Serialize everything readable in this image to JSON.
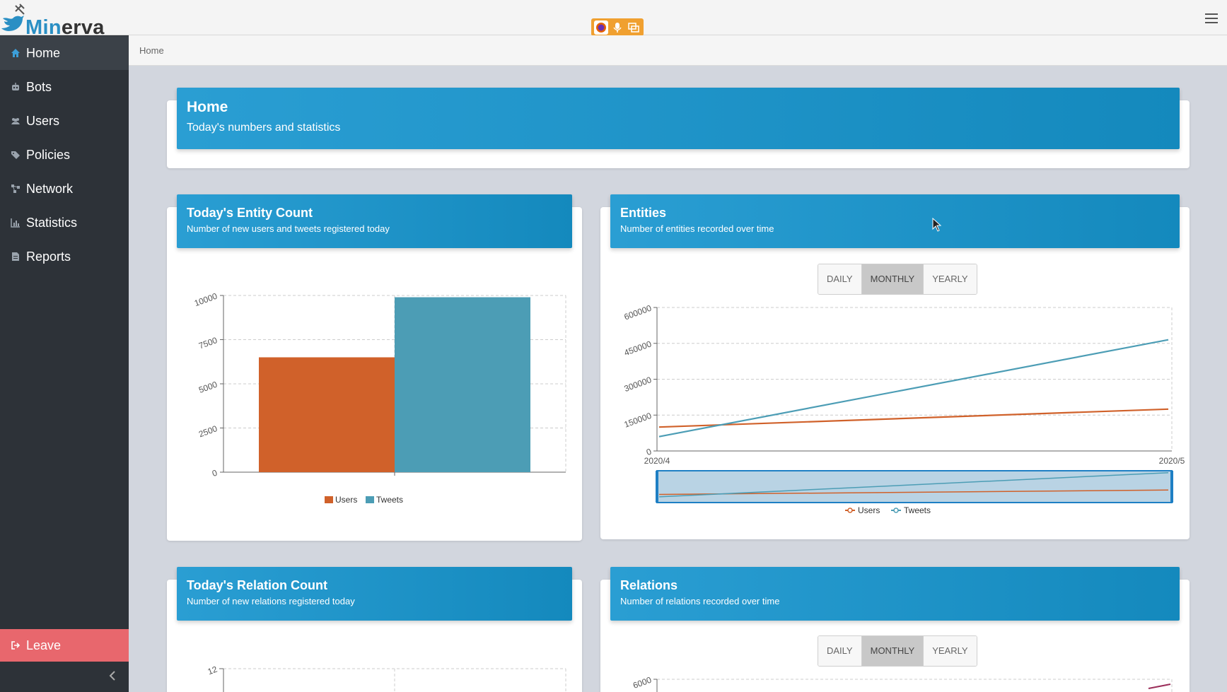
{
  "app": {
    "logo_part1": "Min",
    "logo_part2": "erva"
  },
  "nav": {
    "items": [
      {
        "label": "Home",
        "icon": "home-icon"
      },
      {
        "label": "Bots",
        "icon": "robot-icon"
      },
      {
        "label": "Users",
        "icon": "users-icon"
      },
      {
        "label": "Policies",
        "icon": "tags-icon"
      },
      {
        "label": "Network",
        "icon": "network-icon"
      },
      {
        "label": "Statistics",
        "icon": "chart-icon"
      },
      {
        "label": "Reports",
        "icon": "file-icon"
      }
    ],
    "leave_label": "Leave"
  },
  "breadcrumb": "Home",
  "home_card": {
    "title": "Home",
    "subtitle": "Today's numbers and statistics"
  },
  "entity_count_card": {
    "title": "Today's Entity Count",
    "subtitle": "Number of new users and tweets registered today"
  },
  "entities_card": {
    "title": "Entities",
    "subtitle": "Number of entities recorded over time"
  },
  "relation_count_card": {
    "title": "Today's Relation Count",
    "subtitle": "Number of new relations registered today"
  },
  "relations_card": {
    "title": "Relations",
    "subtitle": "Number of relations recorded over time"
  },
  "period_buttons": [
    "DAILY",
    "MONTHLY",
    "YEARLY"
  ],
  "period_selected": "MONTHLY",
  "colors": {
    "users": "#d0612a",
    "tweets": "#4c9db5",
    "relations": "#9b2e5a",
    "accent": "#1b93c8"
  },
  "chart_data": [
    {
      "type": "bar",
      "categories": [
        "Users",
        "Tweets"
      ],
      "series": [
        {
          "name": "Users",
          "values": [
            6500
          ]
        },
        {
          "name": "Tweets",
          "values": [
            9900
          ]
        }
      ],
      "yticks": [
        "0",
        "2500",
        "5000",
        "7500",
        "10000"
      ],
      "ylim": [
        0,
        10000
      ],
      "legend": [
        "Users",
        "Tweets"
      ],
      "legend_position": "bottom",
      "grid": true
    },
    {
      "type": "line",
      "x": [
        "2020/4",
        "2020/5"
      ],
      "series": [
        {
          "name": "Users",
          "values": [
            100000,
            175000
          ]
        },
        {
          "name": "Tweets",
          "values": [
            60000,
            465000
          ]
        }
      ],
      "yticks": [
        "0",
        "150000",
        "300000",
        "450000",
        "600000"
      ],
      "ylim": [
        0,
        600000
      ],
      "legend": [
        "Users",
        "Tweets"
      ],
      "legend_position": "bottom",
      "grid": true,
      "data_zoom": true
    },
    {
      "type": "bar",
      "yticks": [
        "12"
      ],
      "partial": true
    },
    {
      "type": "line",
      "yticks": [
        "6000"
      ],
      "partial": true
    }
  ]
}
